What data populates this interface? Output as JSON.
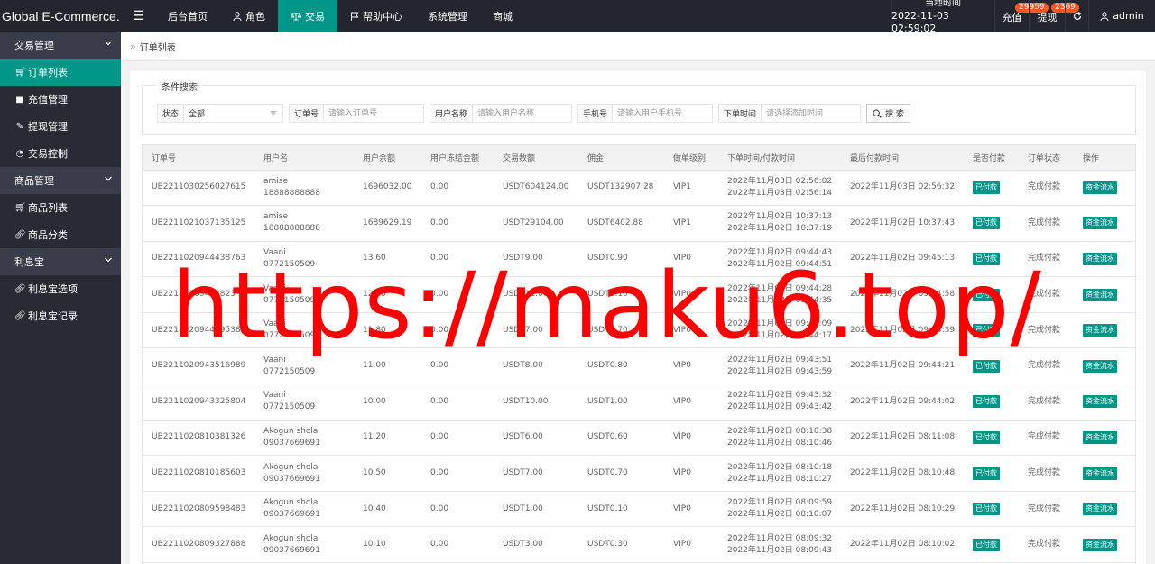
{
  "app": {
    "brand": "Global E-Commerce..."
  },
  "topnav": [
    {
      "label": "后台首页",
      "icon": "",
      "active": false
    },
    {
      "label": "角色",
      "icon": "user-icon",
      "active": false
    },
    {
      "label": "交易",
      "icon": "scale-icon",
      "active": true
    },
    {
      "label": "帮助中心",
      "icon": "flag-icon",
      "active": false
    },
    {
      "label": "系统管理",
      "icon": "",
      "active": false
    },
    {
      "label": "商城",
      "icon": "",
      "active": false
    }
  ],
  "topright": {
    "time_label": "当地时间",
    "time_value": "2022-11-03 02:59:02",
    "recharge_label": "充值",
    "recharge_badge": "29959",
    "withdraw_label": "提现",
    "withdraw_badge": "2369",
    "admin_label": "admin"
  },
  "sidebar": {
    "groups": [
      {
        "label": "交易管理",
        "items": [
          {
            "label": "订单列表",
            "icon": "cart-icon",
            "active": true
          },
          {
            "label": "充值管理",
            "icon": "comment-icon",
            "active": false
          },
          {
            "label": "提现管理",
            "icon": "wrench-icon",
            "active": false
          },
          {
            "label": "交易控制",
            "icon": "dashboard-icon",
            "active": false
          }
        ]
      },
      {
        "label": "商品管理",
        "items": [
          {
            "label": "商品列表",
            "icon": "cart-icon",
            "active": false
          },
          {
            "label": "商品分类",
            "icon": "link-icon",
            "active": false
          }
        ]
      },
      {
        "label": "利息宝",
        "items": [
          {
            "label": "利息宝选项",
            "icon": "link-icon",
            "active": false
          },
          {
            "label": "利息宝记录",
            "icon": "link-icon",
            "active": false
          }
        ]
      }
    ]
  },
  "breadcrumb": {
    "current": "订单列表"
  },
  "search": {
    "legend": "条件搜索",
    "status_label": "状态",
    "status_value": "全部",
    "order_label": "订单号",
    "order_placeholder": "请输入订单号",
    "user_label": "用户名称",
    "user_placeholder": "请输入用户名称",
    "phone_label": "手机号",
    "phone_placeholder": "请输入用户手机号",
    "time_label": "下单时间",
    "time_placeholder": "请选择添加时间",
    "button_label": "搜 索"
  },
  "table": {
    "headers": [
      "订单号",
      "用户名",
      "用户余额",
      "用户冻结金额",
      "交易数额",
      "佣金",
      "做单级别",
      "下单时间/付款时间",
      "最后付款时间",
      "是否付款",
      "订单状态",
      "操作"
    ],
    "rows": [
      {
        "order": "UB2211030256027615",
        "name": "amise",
        "phone": "18888888888",
        "balance": "1696032.00",
        "frozen": "0.00",
        "amount": "USDT604124.00",
        "commission": "USDT132907.28",
        "level": "VIP1",
        "order_time": "2022年11月03日 02:56:02",
        "pay_time": "2022年11月03日 02:56:14",
        "last_pay": "2022年11月03日 02:56:32",
        "paid": "已付款",
        "status": "完成付款",
        "action": "资金流水"
      },
      {
        "order": "UB2211021037135125",
        "name": "amise",
        "phone": "18888888888",
        "balance": "1689629.19",
        "frozen": "0.00",
        "amount": "USDT29104.00",
        "commission": "USDT6402.88",
        "level": "VIP1",
        "order_time": "2022年11月02日 10:37:13",
        "pay_time": "2022年11月02日 10:37:19",
        "last_pay": "2022年11月02日 10:37:43",
        "paid": "已付款",
        "status": "完成付款",
        "action": "资金流水"
      },
      {
        "order": "UB2211020944438763",
        "name": "Vaani",
        "phone": "0772150509",
        "balance": "13.60",
        "frozen": "0.00",
        "amount": "USDT9.00",
        "commission": "USDT0.90",
        "level": "VIP0",
        "order_time": "2022年11月02日 09:44:43",
        "pay_time": "2022年11月02日 09:44:51",
        "last_pay": "2022年11月02日 09:45:13",
        "paid": "已付款",
        "status": "完成付款",
        "action": "资金流水"
      },
      {
        "order": "UB22110209442823",
        "name": "Vaani",
        "phone": "0772150509",
        "balance": "12.70",
        "frozen": "0.00",
        "amount": "USDT11.00",
        "commission": "USDT1.10",
        "level": "VIP0",
        "order_time": "2022年11月02日 09:44:28",
        "pay_time": "2022年11月02日 09:44:35",
        "last_pay": "2022年11月02日 09:44:58",
        "paid": "已付款",
        "status": "完成付款",
        "action": "资金流水"
      },
      {
        "order": "UB2211020944095384",
        "name": "Vaani",
        "phone": "0772150509",
        "balance": "11.80",
        "frozen": "0.00",
        "amount": "USDT7.00",
        "commission": "USDT0.70",
        "level": "VIP0",
        "order_time": "2022年11月02日 09:44:09",
        "pay_time": "2022年11月02日 09:44:17",
        "last_pay": "2022年11月02日 09:44:39",
        "paid": "已付款",
        "status": "完成付款",
        "action": "资金流水"
      },
      {
        "order": "UB2211020943516989",
        "name": "Vaani",
        "phone": "0772150509",
        "balance": "11.00",
        "frozen": "0.00",
        "amount": "USDT8.00",
        "commission": "USDT0.80",
        "level": "VIP0",
        "order_time": "2022年11月02日 09:43:51",
        "pay_time": "2022年11月02日 09:43:59",
        "last_pay": "2022年11月02日 09:44:21",
        "paid": "已付款",
        "status": "完成付款",
        "action": "资金流水"
      },
      {
        "order": "UB2211020943325804",
        "name": "Vaani",
        "phone": "0772150509",
        "balance": "10.00",
        "frozen": "0.00",
        "amount": "USDT10.00",
        "commission": "USDT1.00",
        "level": "VIP0",
        "order_time": "2022年11月02日 09:43:32",
        "pay_time": "2022年11月02日 09:43:42",
        "last_pay": "2022年11月02日 09:44:02",
        "paid": "已付款",
        "status": "完成付款",
        "action": "资金流水"
      },
      {
        "order": "UB2211020810381326",
        "name": "Akogun shola",
        "phone": "09037669691",
        "balance": "11.20",
        "frozen": "0.00",
        "amount": "USDT6.00",
        "commission": "USDT0.60",
        "level": "VIP0",
        "order_time": "2022年11月02日 08:10:38",
        "pay_time": "2022年11月02日 08:10:46",
        "last_pay": "2022年11月02日 08:11:08",
        "paid": "已付款",
        "status": "完成付款",
        "action": "资金流水"
      },
      {
        "order": "UB2211020810185603",
        "name": "Akogun shola",
        "phone": "09037669691",
        "balance": "10.50",
        "frozen": "0.00",
        "amount": "USDT7.00",
        "commission": "USDT0.70",
        "level": "VIP0",
        "order_time": "2022年11月02日 08:10:18",
        "pay_time": "2022年11月02日 08:10:27",
        "last_pay": "2022年11月02日 08:10:48",
        "paid": "已付款",
        "status": "完成付款",
        "action": "资金流水"
      },
      {
        "order": "UB2211020809598483",
        "name": "Akogun shola",
        "phone": "09037669691",
        "balance": "10.40",
        "frozen": "0.00",
        "amount": "USDT1.00",
        "commission": "USDT0.10",
        "level": "VIP0",
        "order_time": "2022年11月02日 08:09:59",
        "pay_time": "2022年11月02日 08:10:07",
        "last_pay": "2022年11月02日 08:10:29",
        "paid": "已付款",
        "status": "完成付款",
        "action": "资金流水"
      },
      {
        "order": "UB2211020809327888",
        "name": "Akogun shola",
        "phone": "09037669691",
        "balance": "10.10",
        "frozen": "0.00",
        "amount": "USDT3.00",
        "commission": "USDT0.30",
        "level": "VIP0",
        "order_time": "2022年11月02日 08:09:32",
        "pay_time": "2022年11月02日 08:09:43",
        "last_pay": "2022年11月02日 08:10:02",
        "paid": "已付款",
        "status": "完成付款",
        "action": "资金流水"
      }
    ]
  },
  "watermark": "https://maku6.top/",
  "colors": {
    "accent": "#009688",
    "topbar": "#23262e",
    "sidebar": "#282b33",
    "badge": "#ff5722",
    "watermark": "#ff0000"
  }
}
